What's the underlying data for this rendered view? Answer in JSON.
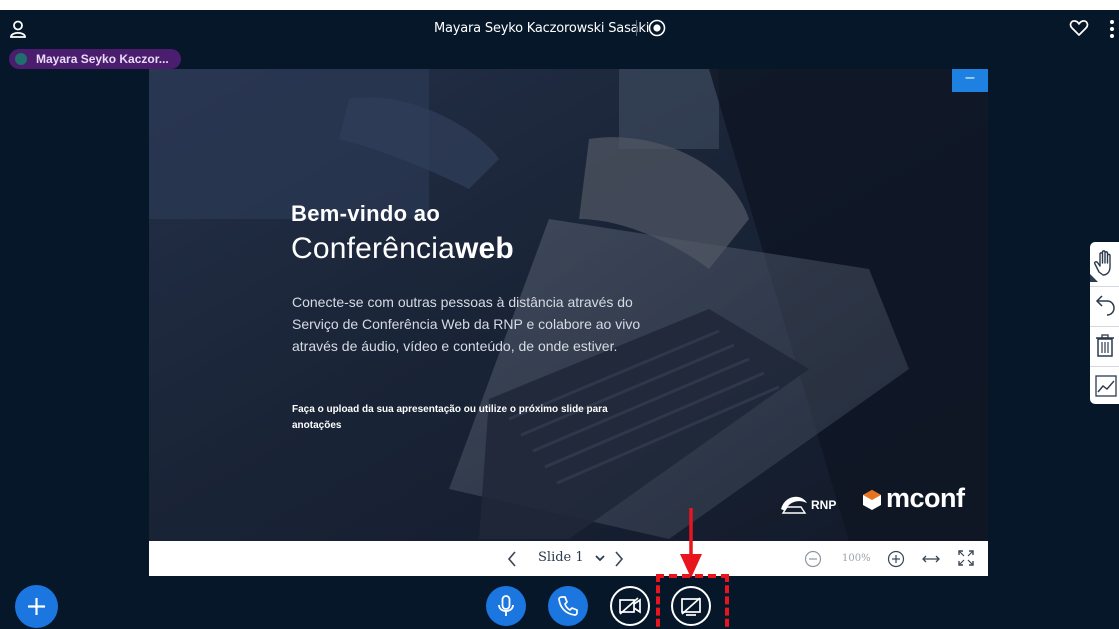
{
  "meeting": {
    "title": "Mayara Seyko Kaczorowski Sasaki",
    "talker": "Mayara Seyko Kaczor..."
  },
  "icons": {
    "user_list": "user-icon",
    "recording": "record-icon",
    "favorite": "heart-icon",
    "options": "more-vertical-icon",
    "actions": "plus-icon",
    "mic": "microphone-icon",
    "audio": "phone-icon",
    "camera": "camera-off-icon",
    "screenshare": "screenshare-off-icon"
  },
  "presentation": {
    "minimize_label": "–",
    "slide_heading_line1": "Bem-vindo ao",
    "slide_heading_line2_light": "Conferência",
    "slide_heading_line2_bold": "web",
    "slide_body": [
      "Conecte-se com outras pessoas à distância através do",
      "Serviço de Conferência Web da RNP e colabore ao vivo",
      "através de áudio, vídeo e conteúdo, de onde estiver."
    ],
    "slide_note_line1": "Faça o upload da sua apresentação ou utilize o próximo slide para",
    "slide_note_line2": "anotações",
    "logo_rnp": "RNP",
    "logo_mconf": "mconf",
    "controls": {
      "current_slide": "Slide 1",
      "zoom": "100%"
    }
  },
  "whiteboard_tools": [
    "hand-icon",
    "undo-icon",
    "trash-icon",
    "line-chart-icon"
  ],
  "colors": {
    "background": "#06172a",
    "accent": "#1b76df",
    "talker_pill": "#4a1d6f",
    "highlight": "#e8141e"
  }
}
